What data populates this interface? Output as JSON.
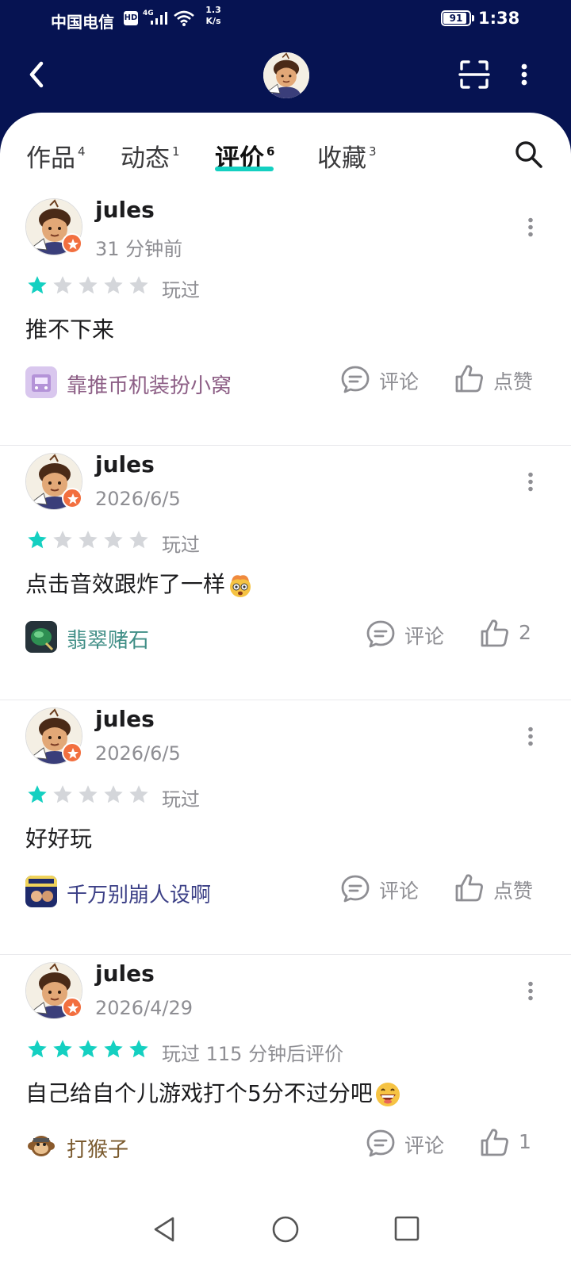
{
  "status_bar": {
    "carrier": "中国电信",
    "hd": "HD",
    "network": "4G",
    "speed_value": "1.3",
    "speed_unit": "K/s",
    "battery": "91",
    "battery_level": 0.91,
    "time": "1:38"
  },
  "header": {
    "back_icon": "chevron-left-icon",
    "scan_icon": "scan-icon",
    "more_icon": "more-vertical-icon"
  },
  "tabs": [
    {
      "label": "作品",
      "count": "4"
    },
    {
      "label": "动态",
      "count": "1"
    },
    {
      "label": "评价",
      "count": "6",
      "active": true
    },
    {
      "label": "收藏",
      "count": "3"
    }
  ],
  "reviews": [
    {
      "user": "jules",
      "time": "31 分钟前",
      "rating": 1,
      "played": "玩过",
      "text": "推不下来",
      "emoji": "",
      "game": "靠推币机装扮小窝",
      "game_color": "#8d5f86",
      "comment_label": "评论",
      "like_label": "点赞"
    },
    {
      "user": "jules",
      "time": "2026/6/5",
      "rating": 1,
      "played": "玩过",
      "text": "点击音效跟炸了一样",
      "emoji": "exploding-head",
      "game": "翡翠赌石",
      "game_color": "#3f8e86",
      "comment_label": "评论",
      "like_label": "2"
    },
    {
      "user": "jules",
      "time": "2026/6/5",
      "rating": 1,
      "played": "玩过",
      "text": "好好玩",
      "emoji": "",
      "game": "千万别崩人设啊",
      "game_color": "#3b3f86",
      "comment_label": "评论",
      "like_label": "点赞"
    },
    {
      "user": "jules",
      "time": "2026/4/29",
      "rating": 5,
      "played": "玩过 115 分钟后评价",
      "text": "自己给自个儿游戏打个5分不过分吧",
      "emoji": "grinning-face",
      "game": "打猴子",
      "game_color": "#7a5a2e",
      "comment_label": "评论",
      "like_label": "1"
    }
  ],
  "colors": {
    "header_bg": "#061352",
    "accent": "#14d0c1",
    "star_on": "#14d0c1",
    "star_off": "#d4d6da",
    "badge": "#f26f3f"
  },
  "nav_bar": {
    "back_icon": "triangle-back-icon",
    "home_icon": "circle-home-icon",
    "recent_icon": "square-recent-icon"
  }
}
